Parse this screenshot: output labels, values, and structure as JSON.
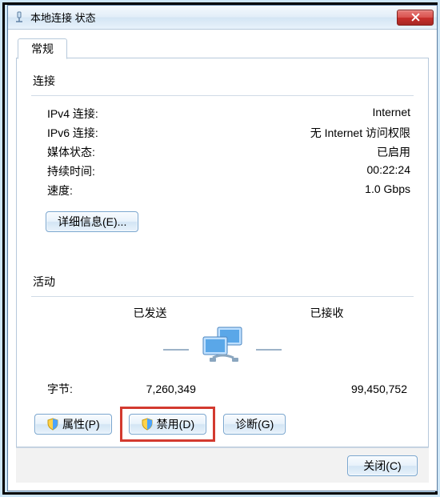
{
  "window": {
    "title": "本地连接 状态"
  },
  "tab": {
    "label": "常规"
  },
  "connection": {
    "section_title": "连接",
    "ipv4_label": "IPv4 连接",
    "ipv4_value": "Internet",
    "ipv6_label": "IPv6 连接",
    "ipv6_value": "无 Internet 访问权限",
    "media_label": "媒体状态",
    "media_value": "已启用",
    "duration_label": "持续时间",
    "duration_value": "00:22:24",
    "speed_label": "速度",
    "speed_value": "1.0 Gbps"
  },
  "details_button": "详细信息(E)...",
  "activity": {
    "section_title": "活动",
    "sent_label": "已发送",
    "received_label": "已接收",
    "bytes_label": "字节",
    "bytes_sent": "7,260,349",
    "bytes_received": "99,450,752"
  },
  "buttons": {
    "properties": "属性(P)",
    "disable": "禁用(D)",
    "diagnose": "诊断(G)",
    "close": "关闭(C)"
  }
}
